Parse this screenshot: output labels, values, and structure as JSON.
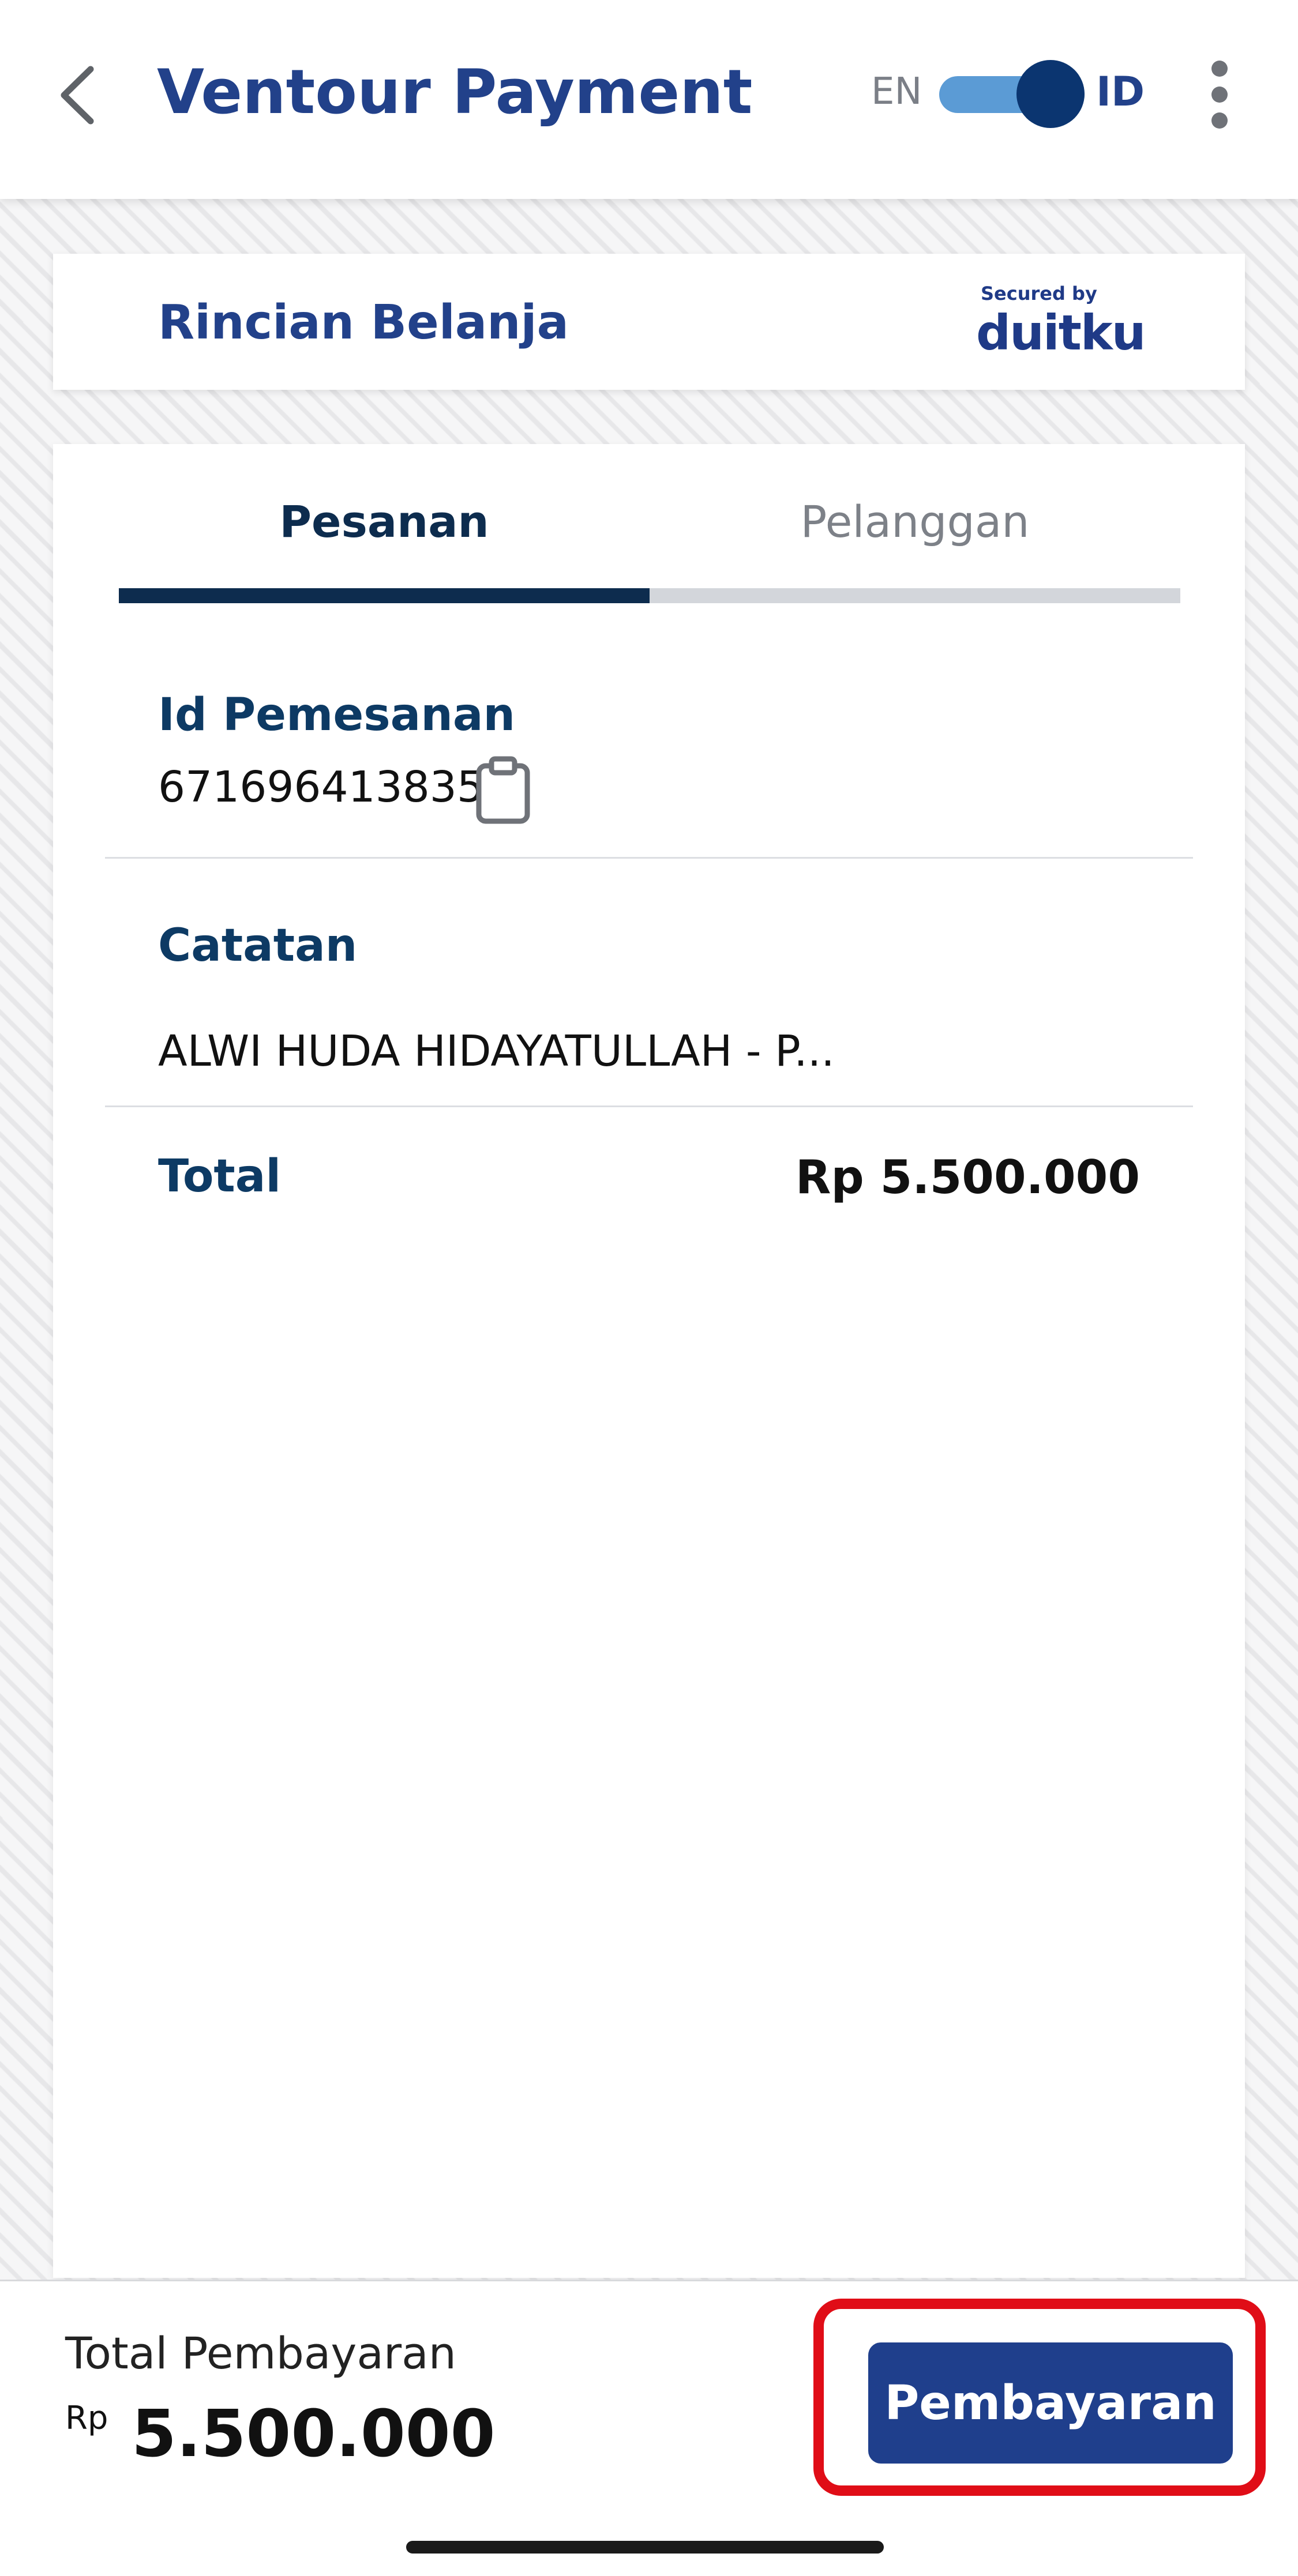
{
  "header": {
    "title": "Ventour Payment",
    "lang_en": "EN",
    "lang_id": "ID",
    "toggle_on": true
  },
  "summary": {
    "title": "Rincian Belanja",
    "secured_by": "Secured by",
    "brand": "duitku"
  },
  "tabs": [
    {
      "label": "Pesanan",
      "active": true
    },
    {
      "label": "Pelanggan",
      "active": false
    }
  ],
  "order": {
    "id_label": "Id Pemesanan",
    "id_value": "671696413835",
    "note_label": "Catatan",
    "note_value": "ALWI HUDA HIDAYATULLAH - P...",
    "total_label": "Total",
    "total_value": "Rp 5.500.000"
  },
  "footer": {
    "total_label": "Total Pembayaran",
    "currency": "Rp",
    "amount": "5.500.000",
    "pay_button": "Pembayaran"
  },
  "colors": {
    "primary": "#22418a",
    "dark_navy": "#0d2c4e",
    "button": "#1f3f8c",
    "highlight": "#e00d17",
    "toggle_track": "#5b9bd5"
  }
}
